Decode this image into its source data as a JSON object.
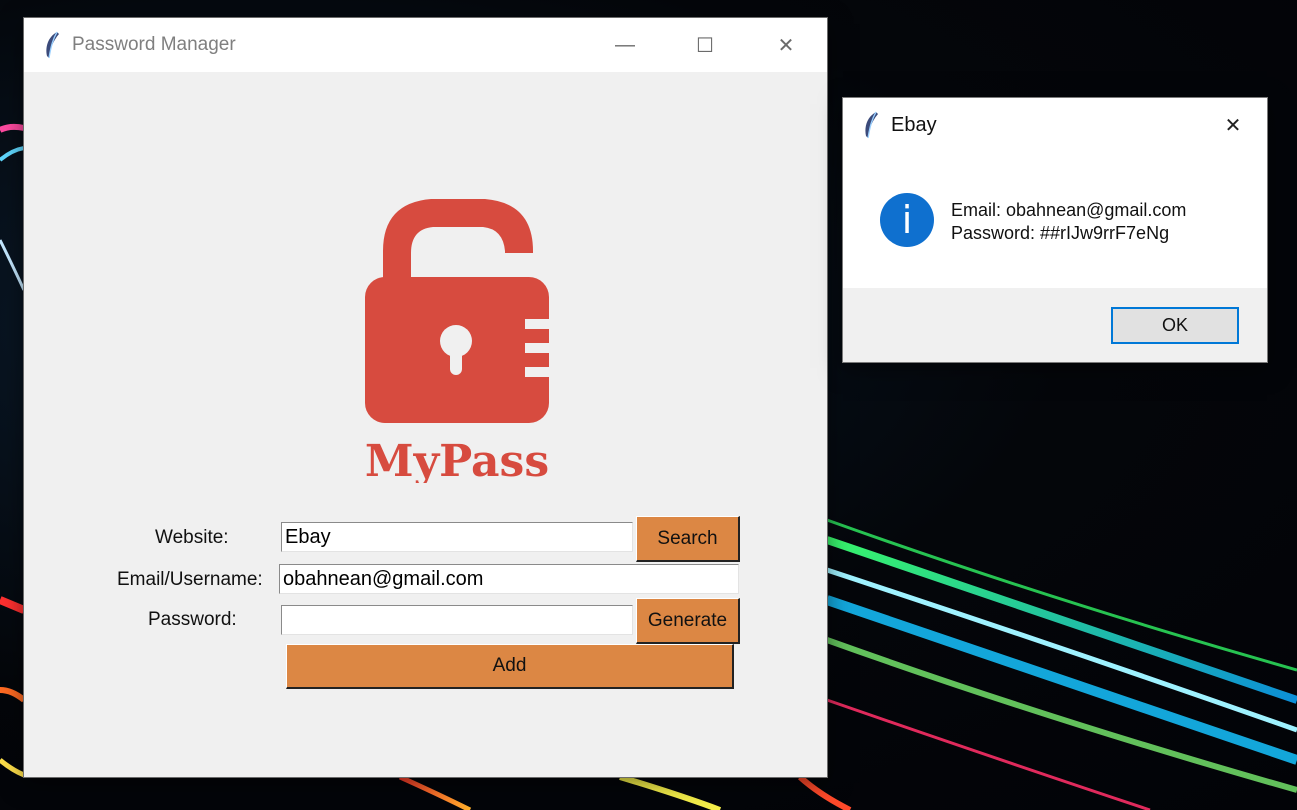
{
  "main_window": {
    "title": "Password Manager",
    "controls": {
      "minimize": "—",
      "maximize": "☐",
      "close": "✕"
    },
    "logo_text": "MyPass",
    "form": {
      "website_label": "Website:",
      "website_value": "Ebay",
      "email_label": "Email/Username:",
      "email_value": "obahnean@gmail.com",
      "password_label": "Password:",
      "password_value": "",
      "search_button": "Search",
      "generate_button": "Generate",
      "add_button": "Add"
    }
  },
  "message_box": {
    "title": "Ebay",
    "close": "✕",
    "icon_glyph": "i",
    "line1": "Email: obahnean@gmail.com",
    "line2": "Password: ##rIJw9rrF7eNg",
    "ok_button": "OK"
  },
  "colors": {
    "accent_button": "#dc8744",
    "logo_red": "#d74b3f",
    "info_blue": "#0f70cf",
    "focus_blue": "#0078d7"
  }
}
